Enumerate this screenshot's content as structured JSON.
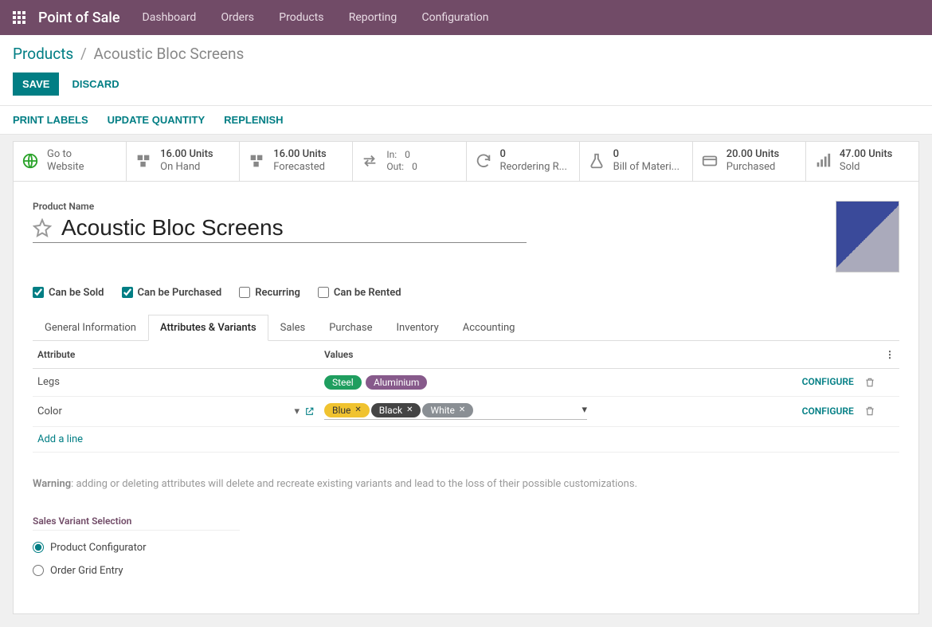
{
  "app_title": "Point of Sale",
  "topnav": [
    "Dashboard",
    "Orders",
    "Products",
    "Reporting",
    "Configuration"
  ],
  "breadcrumb": {
    "parent": "Products",
    "current": "Acoustic Bloc Screens"
  },
  "buttons": {
    "save": "SAVE",
    "discard": "DISCARD"
  },
  "subactions": [
    "PRINT LABELS",
    "UPDATE QUANTITY",
    "REPLENISH"
  ],
  "stats": {
    "website": {
      "l1": "Go to",
      "l2": "Website"
    },
    "onhand": {
      "value": "16.00 Units",
      "label": "On Hand"
    },
    "forecasted": {
      "value": "16.00 Units",
      "label": "Forecasted"
    },
    "in": {
      "label": "In:",
      "value": "0"
    },
    "out": {
      "label": "Out:",
      "value": "0"
    },
    "reorder": {
      "value": "0",
      "label": "Reordering R..."
    },
    "bom": {
      "value": "0",
      "label": "Bill of Materi..."
    },
    "purchased": {
      "value": "20.00 Units",
      "label": "Purchased"
    },
    "sold": {
      "value": "47.00 Units",
      "label": "Sold"
    }
  },
  "product": {
    "name_label": "Product Name",
    "name": "Acoustic Bloc Screens"
  },
  "checks": {
    "sold": {
      "label": "Can be Sold",
      "checked": true
    },
    "purchased": {
      "label": "Can be Purchased",
      "checked": true
    },
    "recurring": {
      "label": "Recurring",
      "checked": false
    },
    "rented": {
      "label": "Can be Rented",
      "checked": false
    }
  },
  "tabs": [
    "General Information",
    "Attributes & Variants",
    "Sales",
    "Purchase",
    "Inventory",
    "Accounting"
  ],
  "active_tab": 1,
  "attr_headers": {
    "attribute": "Attribute",
    "values": "Values"
  },
  "attributes": [
    {
      "name": "Legs",
      "editable": false,
      "values": [
        {
          "label": "Steel",
          "color": "green"
        },
        {
          "label": "Aluminium",
          "color": "purple"
        }
      ]
    },
    {
      "name": "Color",
      "editable": true,
      "values": [
        {
          "label": "Blue",
          "color": "yellow"
        },
        {
          "label": "Black",
          "color": "black"
        },
        {
          "label": "White",
          "color": "grey"
        }
      ]
    }
  ],
  "links": {
    "configure": "CONFIGURE",
    "add_line": "Add a line"
  },
  "warning": {
    "label": "Warning",
    "text": ": adding or deleting attributes will delete and recreate existing variants and lead to the loss of their possible customizations."
  },
  "variant_section": "Sales Variant Selection",
  "variant_options": [
    {
      "label": "Product Configurator",
      "checked": true
    },
    {
      "label": "Order Grid Entry",
      "checked": false
    }
  ]
}
